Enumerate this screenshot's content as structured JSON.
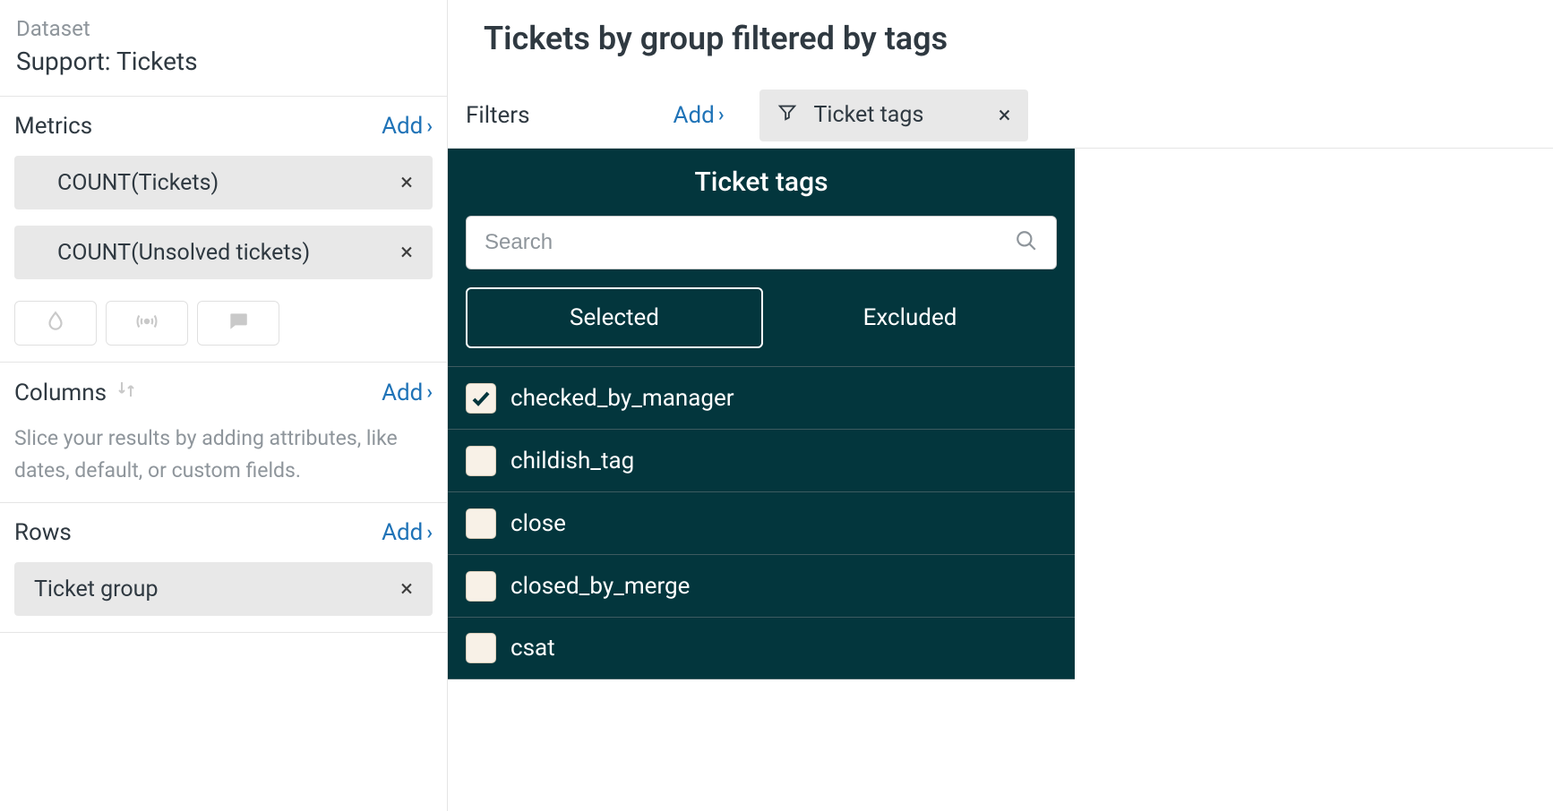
{
  "sidebar": {
    "dataset_label": "Dataset",
    "dataset_name": "Support: Tickets",
    "metrics": {
      "title": "Metrics",
      "add_label": "Add",
      "items": [
        {
          "label": "COUNT(Tickets)"
        },
        {
          "label": "COUNT(Unsolved tickets)"
        }
      ]
    },
    "columns": {
      "title": "Columns",
      "add_label": "Add",
      "helper": "Slice your results by adding attributes, like dates, default, or custom fields."
    },
    "rows": {
      "title": "Rows",
      "add_label": "Add",
      "items": [
        {
          "label": "Ticket group"
        }
      ]
    }
  },
  "main": {
    "title": "Tickets by group filtered by tags",
    "filters_label": "Filters",
    "filters_add_label": "Add",
    "filter_chip": "Ticket tags"
  },
  "popover": {
    "title": "Ticket tags",
    "search_placeholder": "Search",
    "tab_selected": "Selected",
    "tab_excluded": "Excluded",
    "tags": [
      {
        "label": "checked_by_manager",
        "checked": true
      },
      {
        "label": "childish_tag",
        "checked": false
      },
      {
        "label": "close",
        "checked": false
      },
      {
        "label": "closed_by_merge",
        "checked": false
      },
      {
        "label": "csat",
        "checked": false
      }
    ]
  }
}
